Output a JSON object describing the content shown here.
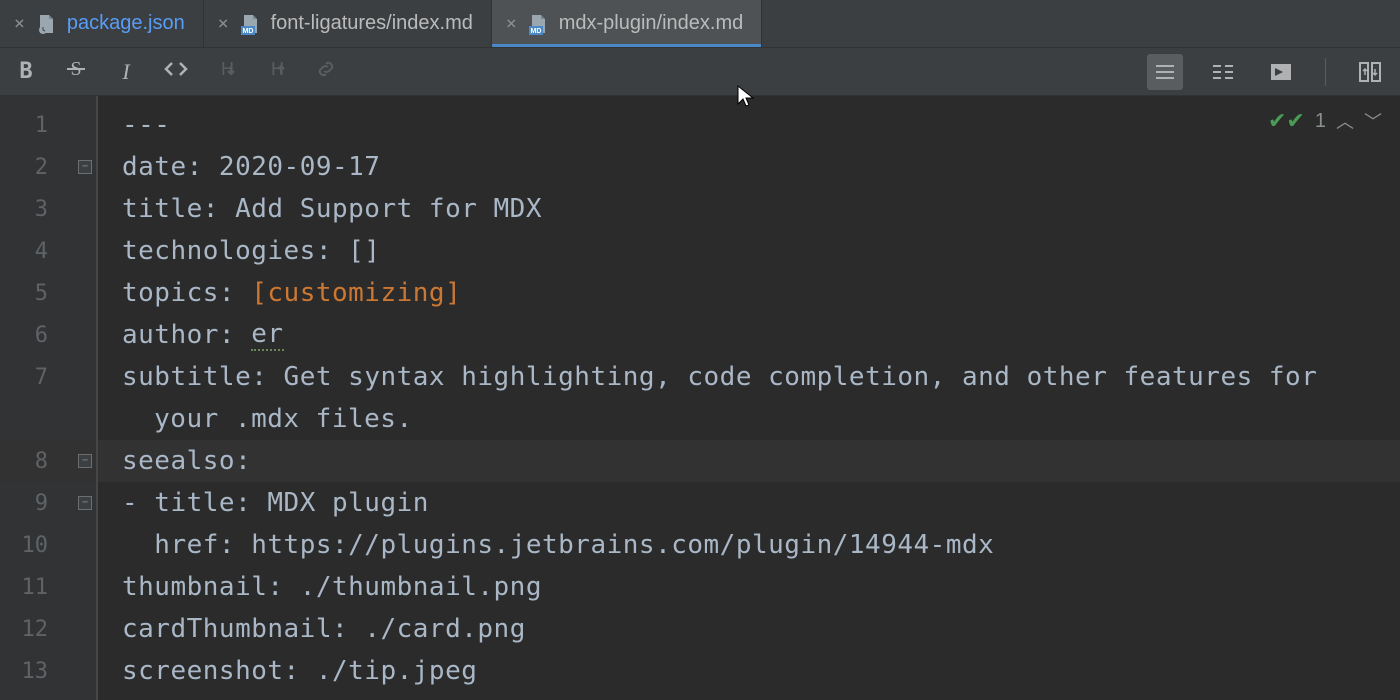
{
  "tabs": [
    {
      "label": "package.json",
      "icon": "json",
      "modified": true
    },
    {
      "label": "font-ligatures/index.md",
      "icon": "md",
      "modified": false
    },
    {
      "label": "mdx-plugin/index.md",
      "icon": "md",
      "modified": false,
      "active": true
    }
  ],
  "toolbar": {
    "bold": "B",
    "strike": "S",
    "italic": "I",
    "code": "<>",
    "h_down": "H↓",
    "h_up": "H↑",
    "link": "🔗"
  },
  "inspection": {
    "count": "1"
  },
  "lines": {
    "l1": "1",
    "l2": "2",
    "l3": "3",
    "l4": "4",
    "l5": "5",
    "l6": "6",
    "l7": "7",
    "l8": "8",
    "l9": "9",
    "l10": "10",
    "l11": "11",
    "l12": "12",
    "l13": "13"
  },
  "code": {
    "l1": "---",
    "l2_k": "date: ",
    "l2_v": "2020-09-17",
    "l3_k": "title: ",
    "l3_v": "Add Support for MDX",
    "l4_k": "technologies: ",
    "l4_v": "[]",
    "l5_k": "topics: ",
    "l5_v": "[customizing]",
    "l6_k": "author: ",
    "l6_v": "er",
    "l7_k": "subtitle: ",
    "l7_v": "Get syntax highlighting, code completion, and other features for",
    "l7b": " your .mdx files.",
    "l8_k": "seealso:",
    "l9_k": "- title: ",
    "l9_v": "MDX plugin",
    "l10_k": "  href: ",
    "l10_v": "https://plugins.jetbrains.com/plugin/14944-mdx",
    "l11_k": "thumbnail: ",
    "l11_v": "./thumbnail.png",
    "l12_k": "cardThumbnail: ",
    "l12_v": "./card.png",
    "l13_k": "screenshot: ",
    "l13_v": "./tip.jpeg"
  }
}
